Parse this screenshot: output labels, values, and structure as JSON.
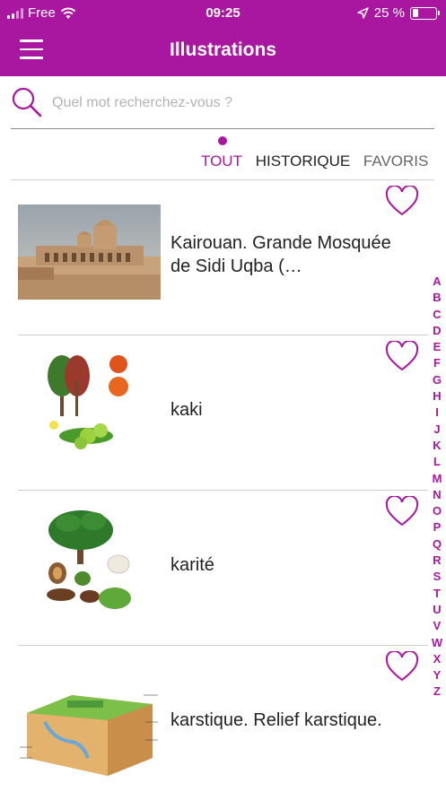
{
  "status_bar": {
    "carrier": "Free",
    "time": "09:25",
    "battery": "25 %",
    "battery_level": 0.25
  },
  "header": {
    "title": "Illustrations",
    "menu_icon": "menu-icon"
  },
  "search": {
    "placeholder": "Quel mot recherchez-vous ?",
    "value": ""
  },
  "tabs": [
    {
      "label": "TOUT",
      "active": true
    },
    {
      "label": "HISTORIQUE",
      "active": false
    },
    {
      "label": "FAVORIS",
      "active": false
    }
  ],
  "items": [
    {
      "label": "Kairouan. Grande Mosquée de Sidi Uqba (…",
      "thumb_icon": "mosque-photo"
    },
    {
      "label": "kaki",
      "thumb_icon": "kaki-illustration"
    },
    {
      "label": "karité",
      "thumb_icon": "karite-illustration"
    },
    {
      "label": "karstique. Relief karstique.",
      "thumb_icon": "karst-illustration"
    }
  ],
  "alphabet": [
    "A",
    "B",
    "C",
    "D",
    "E",
    "F",
    "G",
    "H",
    "I",
    "J",
    "K",
    "L",
    "M",
    "N",
    "O",
    "P",
    "Q",
    "R",
    "S",
    "T",
    "U",
    "V",
    "W",
    "X",
    "Y",
    "Z"
  ],
  "colors": {
    "accent": "#a9169f",
    "text": "#222222",
    "placeholder": "#b3b3b3"
  }
}
